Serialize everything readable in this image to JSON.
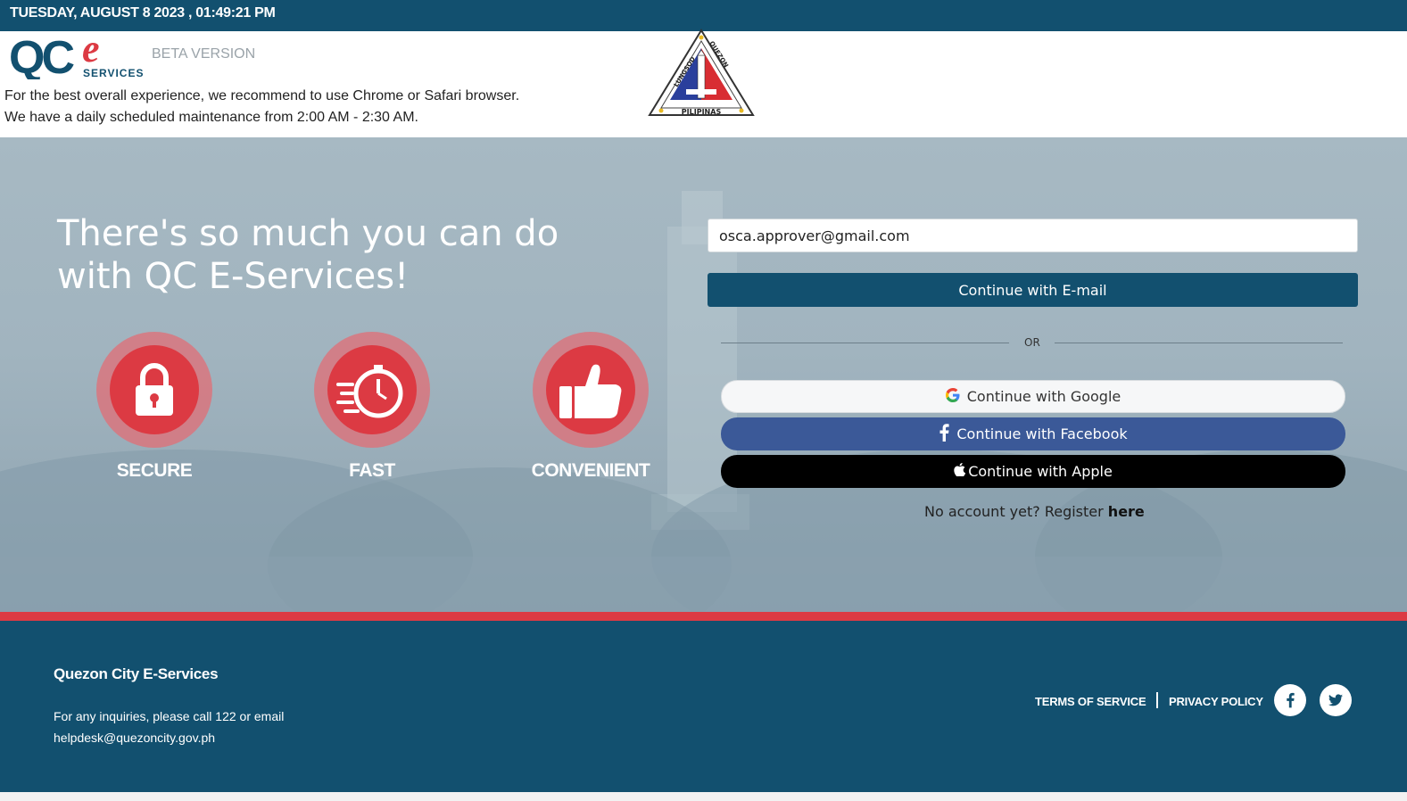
{
  "topbar": {
    "datetime": "TUESDAY, AUGUST 8 2023 , 01:49:21 PM"
  },
  "header": {
    "logo_text_main": "QC",
    "logo_text_e": "e",
    "logo_text_sub": "SERVICES",
    "beta_label": "BETA VERSION",
    "notice_line1": "For the best overall experience, we recommend to use Chrome or Safari browser.",
    "notice_line2": "We have a daily scheduled maintenance from 2:00 AM - 2:30 AM.",
    "seal_text_top_left": "LUNGSOD",
    "seal_text_top_right": "QUEZON",
    "seal_text_bottom": "PILIPINAS"
  },
  "hero": {
    "headline_line1": "There's so much you can do",
    "headline_line2": "with QC E-Services!",
    "features": [
      {
        "label": "SECURE",
        "icon": "padlock-icon"
      },
      {
        "label": "FAST",
        "icon": "stopwatch-icon"
      },
      {
        "label": "CONVENIENT",
        "icon": "thumbs-up-icon"
      }
    ]
  },
  "login": {
    "email_value": "osca.approver@gmail.com",
    "continue_email_label": "Continue with E-mail",
    "or_label": "OR",
    "google_label": "Continue with Google",
    "facebook_label": "Continue with Facebook",
    "apple_label": "Continue with Apple",
    "register_prefix": "No account yet? Register ",
    "register_link": "here"
  },
  "footer": {
    "title": "Quezon City E-Services",
    "info_line1": "For any inquiries, please call 122 or email",
    "info_line2": "helpdesk@quezoncity.gov.ph",
    "terms_label": "TERMS OF SERVICE",
    "privacy_label": "PRIVACY POLICY",
    "social_icons": [
      "facebook-icon",
      "twitter-icon"
    ]
  },
  "colors": {
    "brand_blue": "#12506f",
    "brand_red": "#dc3a43",
    "facebook_blue": "#3b5998",
    "apple_black": "#000000"
  }
}
